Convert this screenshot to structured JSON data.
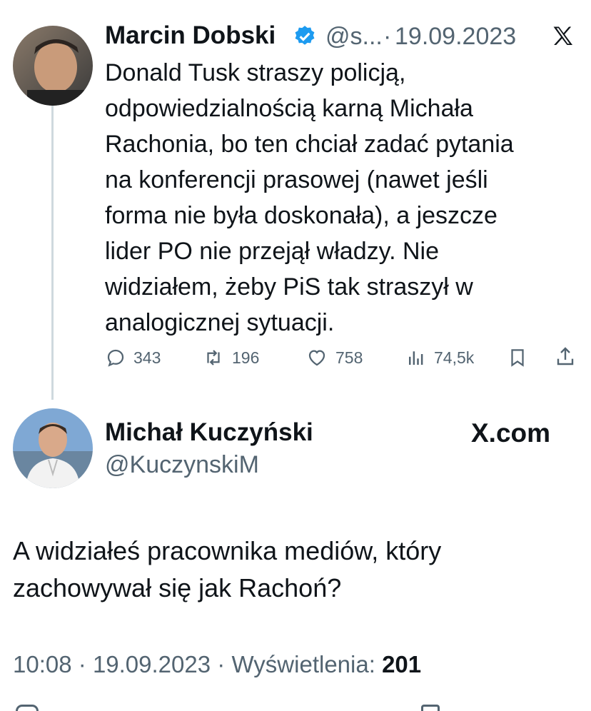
{
  "colors": {
    "verified": "#1d9bf0",
    "text": "#0f1419",
    "muted": "#536471",
    "line": "#cfd9de"
  },
  "parent_tweet": {
    "author_name": "Marcin Dobski",
    "handle": "@s...",
    "separator": "·",
    "date": "19.09.2023",
    "verified_icon": "verified-badge-icon",
    "platform_icon": "x-logo-icon",
    "text": "Donald Tusk straszy policją, odpowiedzialnością karną Michała Rachonia, bo ten chciał zadać pytania na konferencji prasowej (nawet jeśli forma nie była doskonała), a jeszcze lider PO nie przejął władzy. Nie widziałem, żeby PiS tak straszył w analogicznej sytuacji.",
    "lines": [
      "Donald Tusk straszy policją,",
      "odpowiedzialnością karną Michała",
      "Rachonia, bo ten chciał zadać pytania",
      "na konferencji prasowej (nawet jeśli",
      "forma nie była doskonała), a jeszcze",
      "lider PO nie przejął władzy. Nie",
      "widziałem, żeby PiS tak straszył w",
      "analogicznej sytuacji."
    ],
    "actions": {
      "replies": "343",
      "reposts": "196",
      "likes": "758",
      "views": "74,5k"
    }
  },
  "reply_tweet": {
    "author_name": "Michał Kuczyński",
    "handle": "@KuczynskiM",
    "platform_label": "X.com",
    "lines": [
      "A widziałeś pracownika mediów, który",
      "zachowywał się jak Rachoń?"
    ],
    "time": "10:08",
    "date": "19.09.2023",
    "views_label": "Wyświetlenia:",
    "views_count": "201"
  }
}
